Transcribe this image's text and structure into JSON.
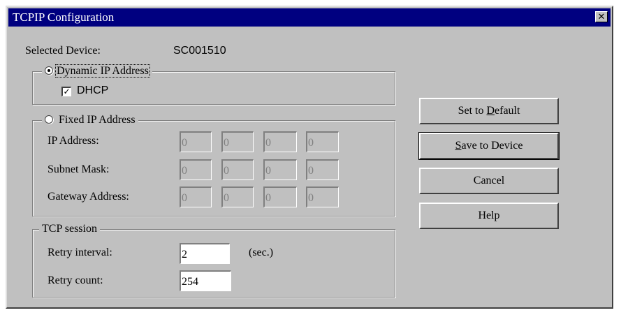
{
  "window": {
    "title": "TCPIP Configuration",
    "close_glyph": "✕"
  },
  "device": {
    "label": "Selected Device:",
    "value": "SC001510"
  },
  "dynamic_group": {
    "radio_label": "Dynamic IP Address",
    "selected": true,
    "dhcp_label": "DHCP",
    "dhcp_checked": true
  },
  "fixed_group": {
    "radio_label": "Fixed IP Address",
    "selected": false,
    "rows": [
      {
        "label": "IP Address:",
        "octets": [
          "0",
          "0",
          "0",
          "0"
        ]
      },
      {
        "label": "Subnet Mask:",
        "octets": [
          "0",
          "0",
          "0",
          "0"
        ]
      },
      {
        "label": "Gateway Address:",
        "octets": [
          "0",
          "0",
          "0",
          "0"
        ]
      }
    ]
  },
  "tcp_group": {
    "title": "TCP session",
    "retry_interval_label": "Retry interval:",
    "retry_interval_value": "2",
    "retry_interval_unit": "(sec.)",
    "retry_count_label": "Retry count:",
    "retry_count_value": "254"
  },
  "buttons": {
    "set_default": {
      "pre": "Set to ",
      "accel": "D",
      "post": "efault"
    },
    "save_device": {
      "pre": "",
      "accel": "S",
      "post": "ave to Device"
    },
    "cancel": "Cancel",
    "help": "Help"
  },
  "colors": {
    "titlebar": "#000080",
    "face": "#c0c0c0"
  },
  "icons": {
    "close": "close-icon",
    "checkbox_mark": "checkmark-icon",
    "radio_dot": "radio-dot-icon"
  }
}
